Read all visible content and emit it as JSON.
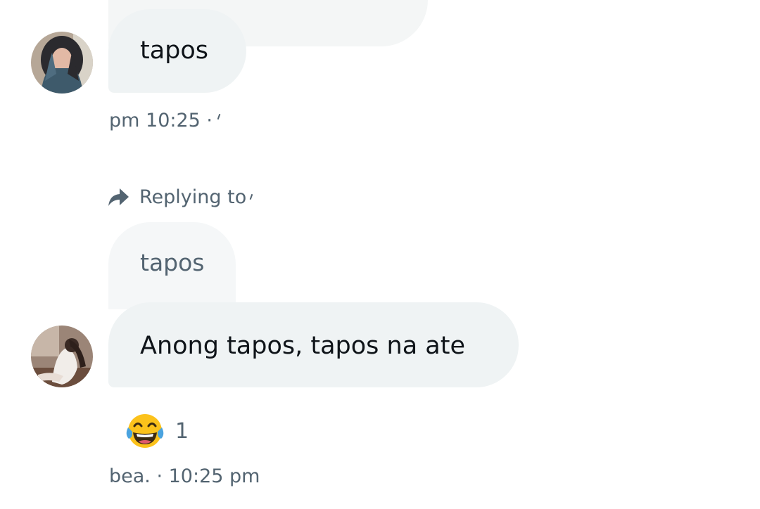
{
  "conversation": {
    "messages": [
      {
        "id": "msg-1",
        "text": "tapos",
        "meta": "pm 10:25 ·"
      },
      {
        "id": "msg-2",
        "replying_label": "Replying to",
        "quoted_text": "tapos",
        "text": "Anong tapos, tapos na ate",
        "reaction": {
          "icon": "face-with-tears-of-joy-emoji",
          "count": "1"
        },
        "meta": "bea. · 10:25 pm"
      }
    ]
  },
  "colors": {
    "bubble": "#eff3f4",
    "quote_bubble": "#f5f7f8",
    "secondary_text": "#536471",
    "primary_text": "#0f1419"
  }
}
